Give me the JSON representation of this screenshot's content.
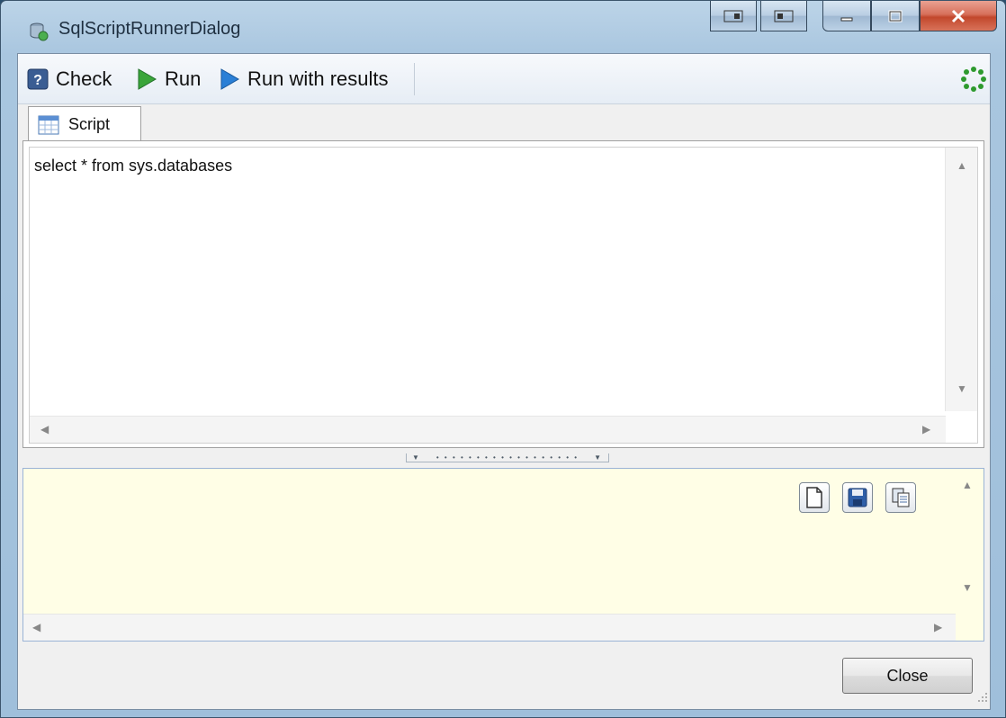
{
  "window": {
    "title": "SqlScriptRunnerDialog",
    "app_icon": "database-script-icon"
  },
  "toolbar": {
    "check_label": "Check",
    "run_label": "Run",
    "run_with_results_label": "Run with results",
    "busy_indicator_icon": "spinner-icon"
  },
  "tabs": [
    {
      "label": "Script",
      "icon": "table-icon",
      "selected": true
    }
  ],
  "editor": {
    "content": "select * from sys.databases"
  },
  "output": {
    "content": "",
    "actions": [
      {
        "name": "new-document-icon"
      },
      {
        "name": "save-icon"
      },
      {
        "name": "copy-icon"
      }
    ]
  },
  "footer": {
    "close_label": "Close"
  },
  "colors": {
    "output_background": "#fffee6",
    "run_green": "#3aa53a",
    "run_blue": "#2a7fd6"
  }
}
